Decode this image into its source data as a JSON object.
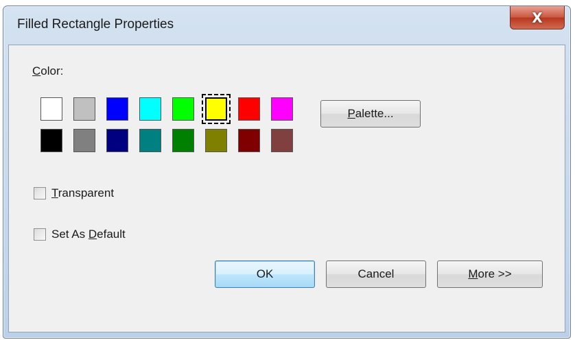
{
  "window": {
    "title": "Filled Rectangle Properties",
    "close_glyph": "X"
  },
  "color": {
    "label": "Color:",
    "selected_index": 5,
    "swatches": [
      {
        "name": "white",
        "hex": "#ffffff"
      },
      {
        "name": "silver",
        "hex": "#c0c0c0"
      },
      {
        "name": "blue",
        "hex": "#0000ff"
      },
      {
        "name": "cyan",
        "hex": "#00ffff"
      },
      {
        "name": "lime",
        "hex": "#00ff00"
      },
      {
        "name": "yellow",
        "hex": "#ffff00"
      },
      {
        "name": "red",
        "hex": "#ff0000"
      },
      {
        "name": "magenta",
        "hex": "#ff00ff"
      },
      {
        "name": "black",
        "hex": "#000000"
      },
      {
        "name": "gray",
        "hex": "#808080"
      },
      {
        "name": "navy",
        "hex": "#000080"
      },
      {
        "name": "teal",
        "hex": "#008080"
      },
      {
        "name": "green",
        "hex": "#008000"
      },
      {
        "name": "olive",
        "hex": "#808000"
      },
      {
        "name": "maroon",
        "hex": "#800000"
      },
      {
        "name": "brown",
        "hex": "#804040"
      }
    ]
  },
  "palette_button": {
    "label": "Palette..."
  },
  "options": {
    "transparent": {
      "label": "Transparent",
      "checked": false
    },
    "set_as_default": {
      "label": "Set As Default",
      "checked": false
    }
  },
  "buttons": {
    "ok": "OK",
    "cancel": "Cancel",
    "more": "More >>"
  }
}
